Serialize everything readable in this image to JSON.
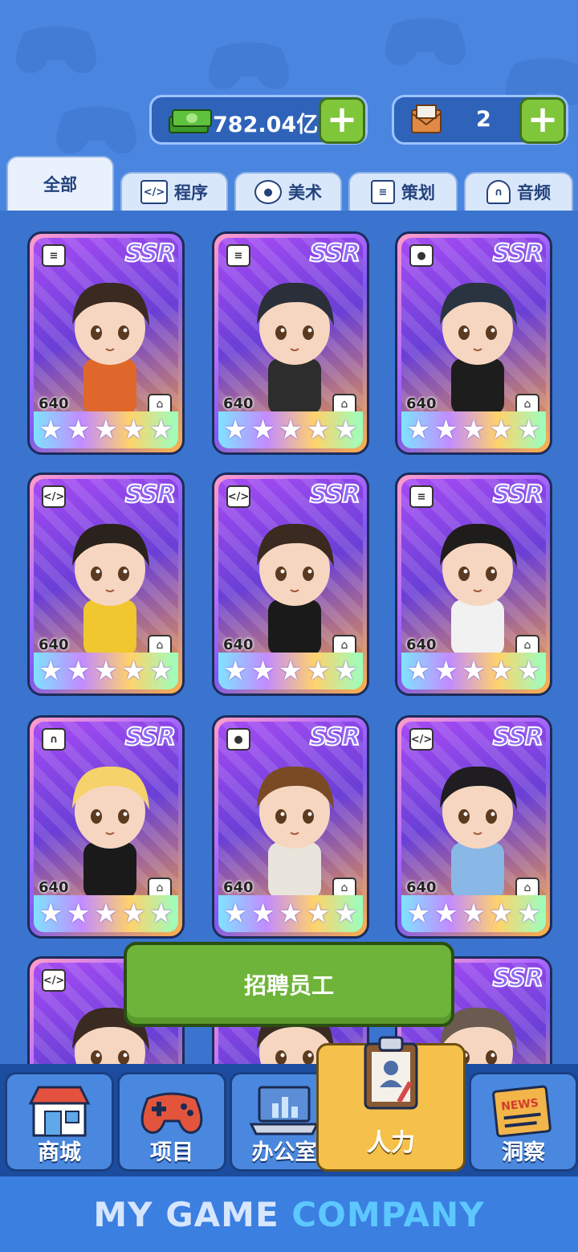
{
  "resources": {
    "money_value": "782.04亿",
    "tickets_value": "2",
    "plus_label": "+"
  },
  "tabs": [
    {
      "label": "全部",
      "icon": "none"
    },
    {
      "label": "程序",
      "icon": "code-monitor-icon"
    },
    {
      "label": "美术",
      "icon": "palette-icon"
    },
    {
      "label": "策划",
      "icon": "document-icon"
    },
    {
      "label": "音频",
      "icon": "headphones-icon"
    }
  ],
  "cards": [
    {
      "rarity": "SSR",
      "level": "640",
      "job_icon": "document-icon",
      "stars": 5,
      "hair": "#3a2a22",
      "shirt": "#e0672b"
    },
    {
      "rarity": "SSR",
      "level": "640",
      "job_icon": "document-icon",
      "stars": 5,
      "hair": "#2b2f3a",
      "shirt": "#2d2d2d"
    },
    {
      "rarity": "SSR",
      "level": "640",
      "job_icon": "palette-icon",
      "stars": 5,
      "hair": "#2a3440",
      "shirt": "#1d1d1d"
    },
    {
      "rarity": "SSR",
      "level": "640",
      "job_icon": "code-monitor-icon",
      "stars": 5,
      "hair": "#2a221c",
      "shirt": "#f0c72e"
    },
    {
      "rarity": "SSR",
      "level": "640",
      "job_icon": "code-monitor-icon",
      "stars": 5,
      "hair": "#3a2a20",
      "shirt": "#1a1a1a"
    },
    {
      "rarity": "SSR",
      "level": "640",
      "job_icon": "document-icon",
      "stars": 5,
      "hair": "#1f1c1c",
      "shirt": "#f1f1f1"
    },
    {
      "rarity": "SSR",
      "level": "640",
      "job_icon": "headphones-icon",
      "stars": 5,
      "hair": "#f5d26a",
      "shirt": "#1a1a1a"
    },
    {
      "rarity": "SSR",
      "level": "640",
      "job_icon": "palette-icon",
      "stars": 5,
      "hair": "#7a4a25",
      "shirt": "#e9e4dc"
    },
    {
      "rarity": "SSR",
      "level": "640",
      "job_icon": "code-monitor-icon",
      "stars": 5,
      "hair": "#1f1c22",
      "shirt": "#89b8e6"
    },
    {
      "rarity": "",
      "level": "",
      "job_icon": "code-monitor-icon",
      "stars": 0,
      "hair": "#3a2a22",
      "shirt": "#333"
    },
    {
      "rarity": "",
      "level": "",
      "job_icon": "none",
      "stars": 0,
      "hair": "#3a2a22",
      "shirt": "#333"
    },
    {
      "rarity": "SSR",
      "level": "",
      "job_icon": "none",
      "stars": 0,
      "hair": "#6a5a50",
      "shirt": "#333"
    }
  ],
  "recruit_button": "招聘员工",
  "nav": [
    {
      "label": "商城",
      "icon": "shop-icon"
    },
    {
      "label": "项目",
      "icon": "gamepad-icon"
    },
    {
      "label": "办公室",
      "icon": "laptop-icon"
    },
    {
      "label": "人力",
      "icon": "clipboard-person-icon"
    },
    {
      "label": "洞察",
      "icon": "news-icon"
    }
  ],
  "news_badge": "NEWS",
  "footer": {
    "word1": "MY GAME",
    "word2": "COMPANY"
  }
}
